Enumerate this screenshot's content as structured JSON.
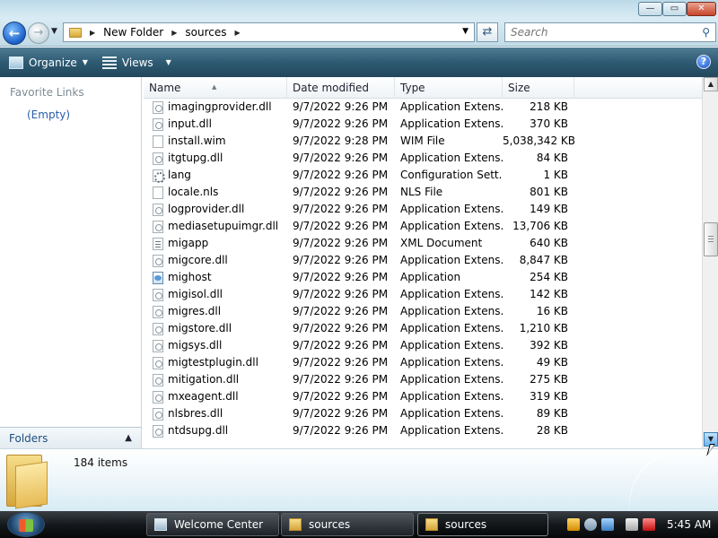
{
  "window": {
    "breadcrumbs": [
      "New Folder",
      "sources"
    ],
    "search_placeholder": "Search",
    "caption": {
      "minimize": "—",
      "maximize": "▭",
      "close": "✕"
    }
  },
  "toolbar": {
    "organize_label": "Organize",
    "views_label": "Views",
    "help_label": "?"
  },
  "nav": {
    "favorite_links_label": "Favorite Links",
    "empty_label": "(Empty)",
    "folders_label": "Folders"
  },
  "columns": {
    "name": "Name",
    "date": "Date modified",
    "type": "Type",
    "size": "Size"
  },
  "files": [
    {
      "name": "imagingprovider.dll",
      "date": "9/7/2022 9:26 PM",
      "type": "Application Extens...",
      "size": "218 KB",
      "icon": "dll"
    },
    {
      "name": "input.dll",
      "date": "9/7/2022 9:26 PM",
      "type": "Application Extens...",
      "size": "370 KB",
      "icon": "dll"
    },
    {
      "name": "install.wim",
      "date": "9/7/2022 9:28 PM",
      "type": "WIM File",
      "size": "5,038,342 KB",
      "icon": "file"
    },
    {
      "name": "itgtupg.dll",
      "date": "9/7/2022 9:26 PM",
      "type": "Application Extens...",
      "size": "84 KB",
      "icon": "dll"
    },
    {
      "name": "lang",
      "date": "9/7/2022 9:26 PM",
      "type": "Configuration Sett...",
      "size": "1 KB",
      "icon": "cfg"
    },
    {
      "name": "locale.nls",
      "date": "9/7/2022 9:26 PM",
      "type": "NLS File",
      "size": "801 KB",
      "icon": "file"
    },
    {
      "name": "logprovider.dll",
      "date": "9/7/2022 9:26 PM",
      "type": "Application Extens...",
      "size": "149 KB",
      "icon": "dll"
    },
    {
      "name": "mediasetupuimgr.dll",
      "date": "9/7/2022 9:26 PM",
      "type": "Application Extens...",
      "size": "13,706 KB",
      "icon": "dll"
    },
    {
      "name": "migapp",
      "date": "9/7/2022 9:26 PM",
      "type": "XML Document",
      "size": "640 KB",
      "icon": "xml"
    },
    {
      "name": "migcore.dll",
      "date": "9/7/2022 9:26 PM",
      "type": "Application Extens...",
      "size": "8,847 KB",
      "icon": "dll"
    },
    {
      "name": "mighost",
      "date": "9/7/2022 9:26 PM",
      "type": "Application",
      "size": "254 KB",
      "icon": "app"
    },
    {
      "name": "migisol.dll",
      "date": "9/7/2022 9:26 PM",
      "type": "Application Extens...",
      "size": "142 KB",
      "icon": "dll"
    },
    {
      "name": "migres.dll",
      "date": "9/7/2022 9:26 PM",
      "type": "Application Extens...",
      "size": "16 KB",
      "icon": "dll"
    },
    {
      "name": "migstore.dll",
      "date": "9/7/2022 9:26 PM",
      "type": "Application Extens...",
      "size": "1,210 KB",
      "icon": "dll"
    },
    {
      "name": "migsys.dll",
      "date": "9/7/2022 9:26 PM",
      "type": "Application Extens...",
      "size": "392 KB",
      "icon": "dll"
    },
    {
      "name": "migtestplugin.dll",
      "date": "9/7/2022 9:26 PM",
      "type": "Application Extens...",
      "size": "49 KB",
      "icon": "dll"
    },
    {
      "name": "mitigation.dll",
      "date": "9/7/2022 9:26 PM",
      "type": "Application Extens...",
      "size": "275 KB",
      "icon": "dll"
    },
    {
      "name": "mxeagent.dll",
      "date": "9/7/2022 9:26 PM",
      "type": "Application Extens...",
      "size": "319 KB",
      "icon": "dll"
    },
    {
      "name": "nlsbres.dll",
      "date": "9/7/2022 9:26 PM",
      "type": "Application Extens...",
      "size": "89 KB",
      "icon": "dll"
    },
    {
      "name": "ntdsupg.dll",
      "date": "9/7/2022 9:26 PM",
      "type": "Application Extens...",
      "size": "28 KB",
      "icon": "dll"
    }
  ],
  "details": {
    "item_count": "184 items"
  },
  "taskbar": {
    "buttons": [
      "Welcome Center",
      "sources",
      "sources"
    ],
    "clock": "5:45 AM"
  },
  "icons": {
    "back": "back-arrow-icon",
    "forward": "forward-arrow-icon",
    "refresh": "refresh-icon",
    "search": "search-icon"
  }
}
